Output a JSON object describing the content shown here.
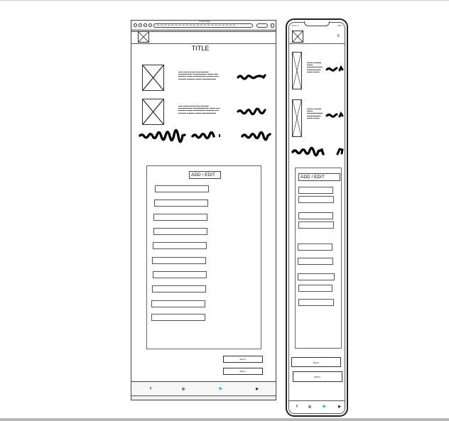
{
  "desktop": {
    "title": "TITLE",
    "window_caption": "Fooki Page",
    "lorem_1": "▬▬ ▬▬▬ ▬▬▬ ▬▬ ▬▬▬▬ ▬▬▬▬▬▬▬ ▬▬▬▬▬▬▬ ▬▬▬ ▬▬ ▬▬▬▬ ▬▬▬ ▬▬▬▬▬▬ ▬▬▬▬ ▬▬ ▬▬▬▬ ▬▬▬▬ ▬▬▬ ▬▬▬▬▬▬▬",
    "lorem_2": "▬▬ ▬▬▬ ▬▬▬ ▬▬ ▬▬▬▬ ▬▬▬▬▬▬▬ ▬▬▬▬▬▬▬▬ ▬▬▬ ▬▬ ▬▬▬▬ ▬▬▬ ▬▬▬▬▬▬ ▬▬▬▬ ▬▬ ▬▬▬▬ ▬▬▬▬ ▬▬▬ ▬▬▬▬▬▬▬",
    "panel_title": "ADD / EDIT",
    "button_1": "Button",
    "button_2": "Button",
    "footer_icons": [
      "f",
      "◎",
      "🐦",
      "▶"
    ]
  },
  "mobile": {
    "status_left": "Carrier ⁂",
    "status_right": "100% ▭",
    "hamburger": "≡",
    "lorem_1": "▬▬▬ ▬▬▬▬ ▬▬▬ ▬▬▬▬▬▬▬▬ ▬▬▬▬▬▬▬ ▬▬▬ ▬▬▬",
    "lorem_2": "▬▬▬ ▬▬▬▬ ▬▬▬ ▬▬▬▬▬▬▬▬ ▬▬▬▬▬▬▬ ▬▬▬ ▬▬▬",
    "panel_title": "ADD / EDIT",
    "button_1": "Button",
    "button_2": "Button",
    "footer_icons": [
      "f",
      "◎",
      "🐦",
      "▶"
    ]
  },
  "icons": {
    "logo": "image-placeholder-icon",
    "facebook": "facebook-icon",
    "instagram": "instagram-icon",
    "twitter": "twitter-icon",
    "youtube": "youtube-icon"
  }
}
